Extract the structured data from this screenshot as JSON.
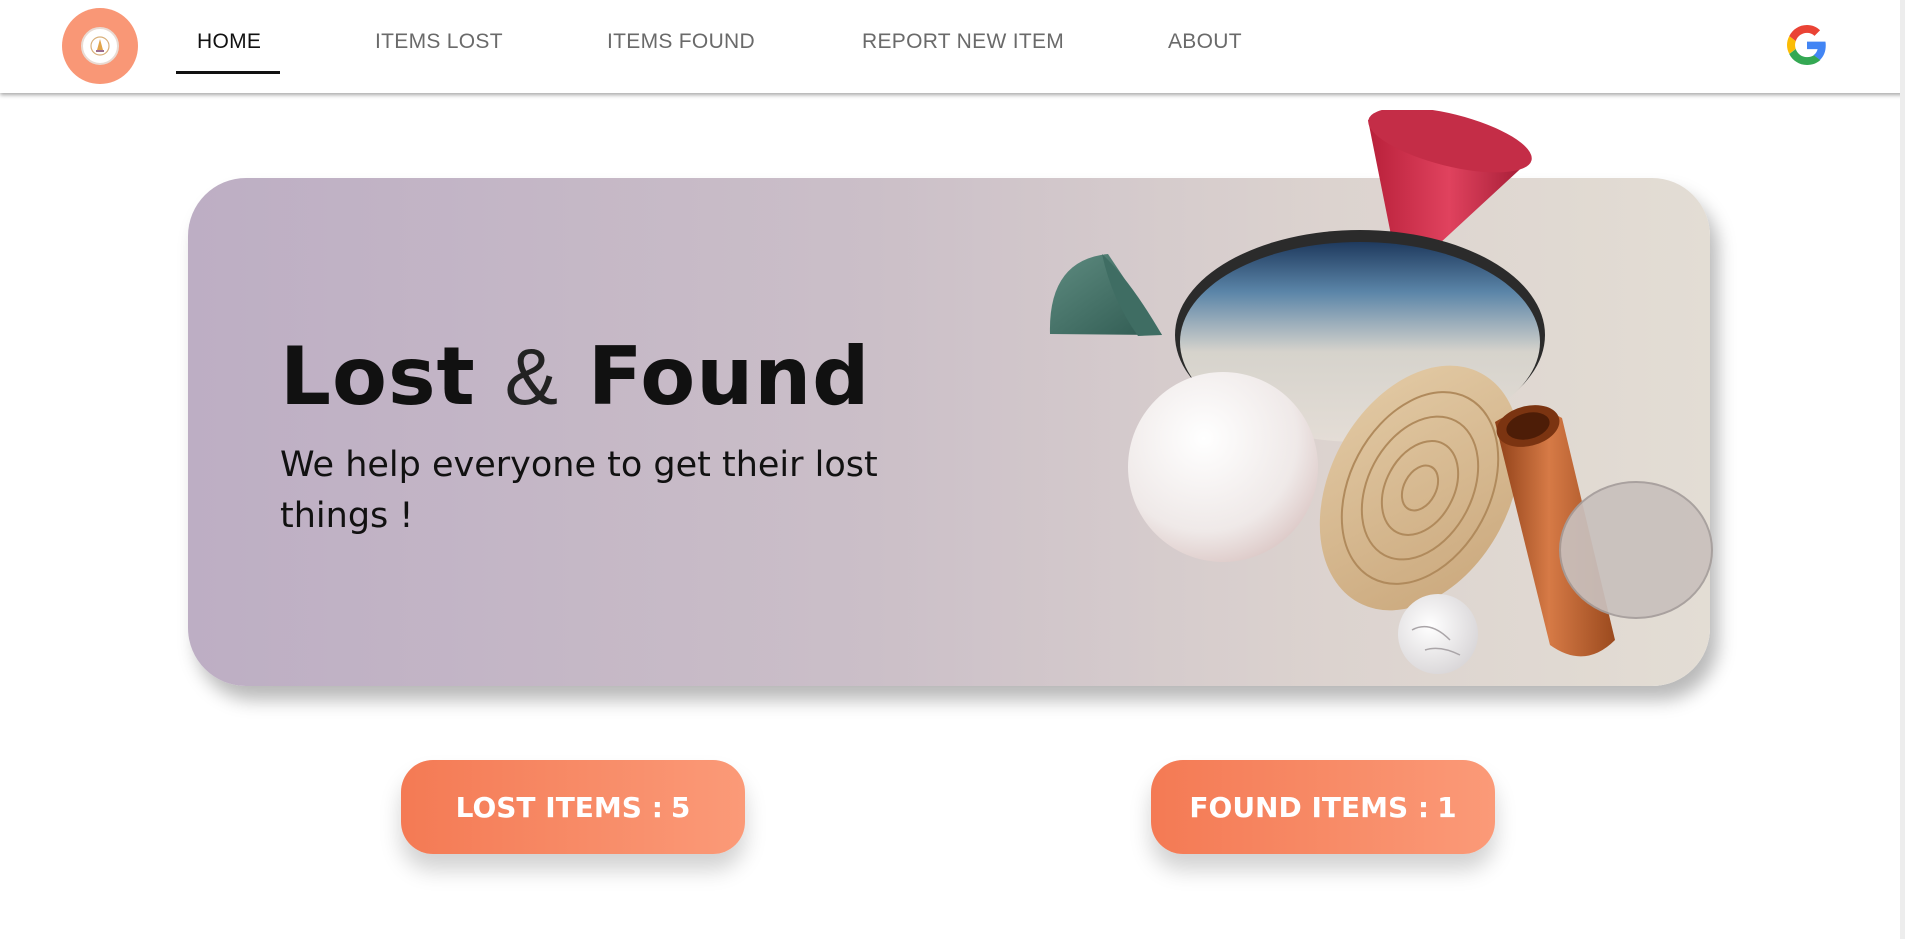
{
  "nav": {
    "items": [
      {
        "label": "HOME",
        "active": true
      },
      {
        "label": "ITEMS LOST",
        "active": false
      },
      {
        "label": "ITEMS FOUND",
        "active": false
      },
      {
        "label": "REPORT NEW ITEM",
        "active": false
      },
      {
        "label": "ABOUT",
        "active": false
      }
    ],
    "logo_icon": "institution-logo-icon",
    "google_icon": "google-icon"
  },
  "hero": {
    "title_part1": "Lost",
    "title_amp": "&",
    "title_part2": "Found",
    "subtitle": "We help everyone to get their lost things !"
  },
  "stats": {
    "lost_label": "LOST ITEMS :",
    "lost_count": "5",
    "found_label": "FOUND ITEMS :",
    "found_count": "1"
  },
  "colors": {
    "accent": "#f47a54",
    "accent_light": "#fb9a78",
    "logo_bg": "#f99776",
    "hero_left": "#bdaec4",
    "hero_right": "#e3ddd4"
  }
}
